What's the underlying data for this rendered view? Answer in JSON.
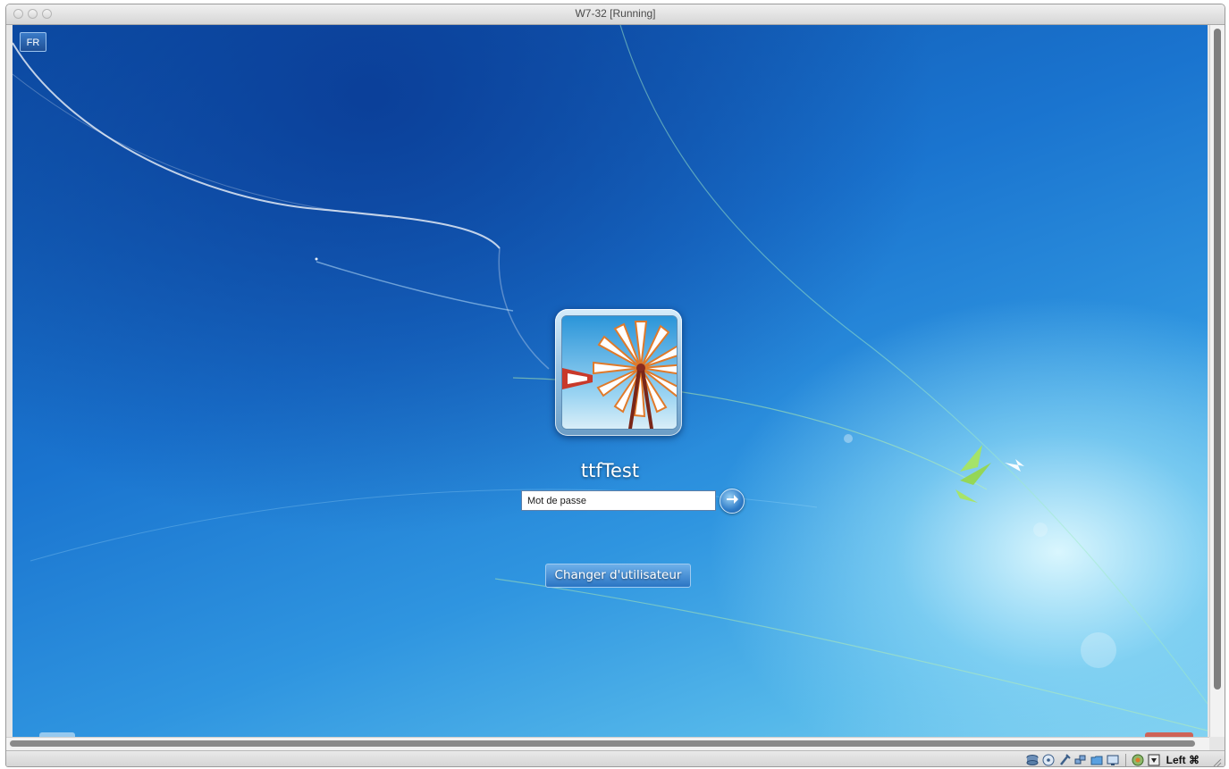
{
  "window": {
    "title": "W7-32 [Running]"
  },
  "vm": {
    "language_indicator": "FR",
    "user": {
      "name": "ttfTest"
    },
    "password_field": {
      "placeholder": "Mot de passe",
      "value": ""
    },
    "submit_icon": "arrow-right-icon",
    "switch_user_label": "Changer d'utilisateur"
  },
  "statusbar": {
    "icons": [
      "hard-disk-icon",
      "optical-drive-icon",
      "usb-icon",
      "network-icon",
      "shared-folders-icon",
      "display-icon",
      "video-capture-icon",
      "mouse-integration-icon"
    ],
    "host_key": "Left ⌘"
  },
  "colors": {
    "accent": "#1a74cf",
    "desktop_light": "#7fd0f0"
  }
}
